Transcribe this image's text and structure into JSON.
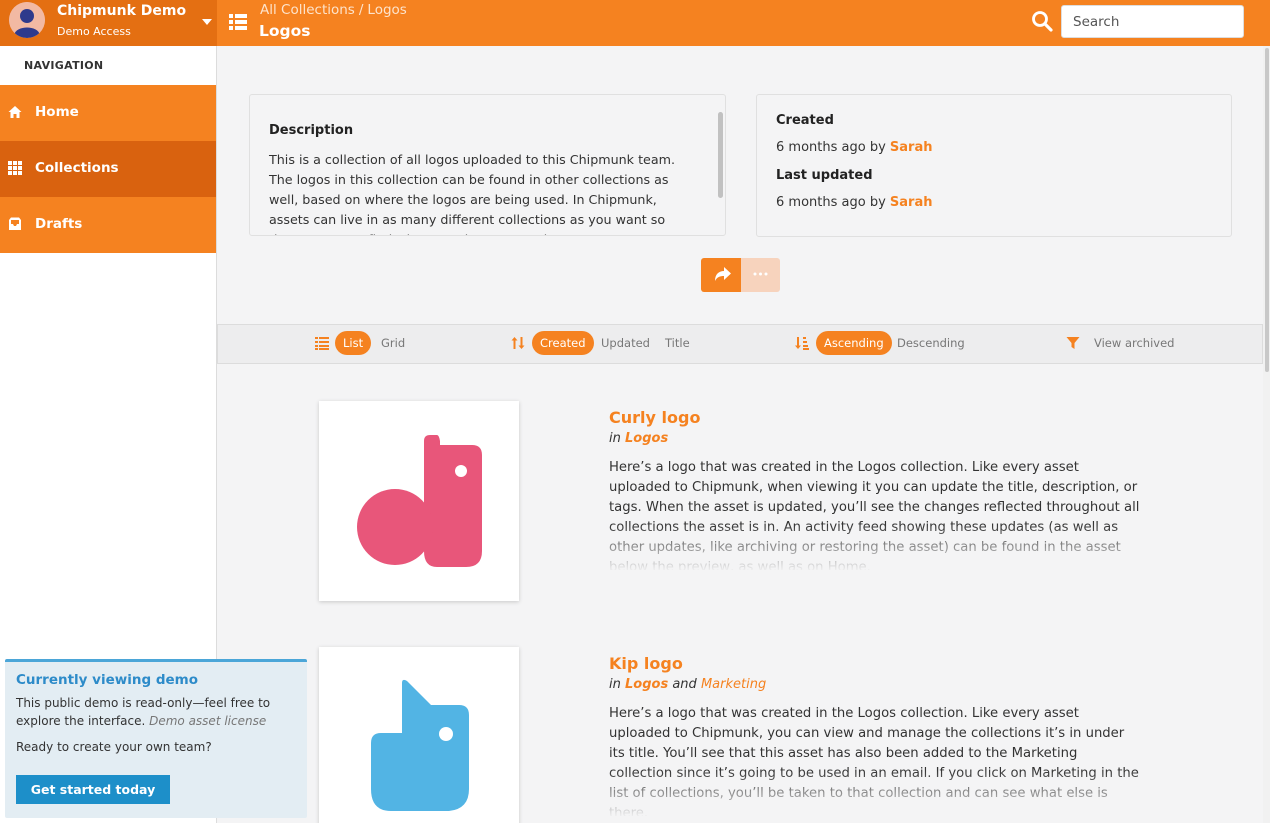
{
  "account": {
    "name": "Chipmunk Demo",
    "subtitle": "Demo Access"
  },
  "header": {
    "breadcrumb": [
      "All Collections",
      "Logos"
    ],
    "breadcrumb_separator": "/",
    "title": "Logos",
    "search_placeholder": "Search"
  },
  "sidebar": {
    "heading": "NAVIGATION",
    "items": [
      {
        "label": "Home",
        "icon": "home-icon",
        "active": false
      },
      {
        "label": "Collections",
        "icon": "grid-icon",
        "active": true
      },
      {
        "label": "Drafts",
        "icon": "inbox-icon",
        "active": false
      }
    ]
  },
  "demo_notice": {
    "title": "Currently viewing demo",
    "text": "This public demo is read-only—feel free to explore the interface.",
    "license_link": "Demo asset license",
    "question": "Ready to create your own team?",
    "button": "Get started today"
  },
  "collection": {
    "description_heading": "Description",
    "description": "This is a collection of all logos uploaded to this Chipmunk team. The logos in this collection can be found in other collections as well, based on where the logos are being used. In Chipmunk, assets can live in as many different collections as you want so they're easy to find wherever they are used.",
    "created_label": "Created",
    "created_time": "6 months ago",
    "created_by_prefix": "by",
    "created_by": "Sarah",
    "updated_label": "Last updated",
    "updated_time": "6 months ago",
    "updated_by_prefix": "by",
    "updated_by": "Sarah"
  },
  "toolbar": {
    "view_options": [
      "List",
      "Grid"
    ],
    "view_selected": "List",
    "sort_options": [
      "Created",
      "Updated",
      "Title"
    ],
    "sort_selected": "Created",
    "order_options": [
      "Ascending",
      "Descending"
    ],
    "order_selected": "Ascending",
    "archived_label": "View archived"
  },
  "assets": [
    {
      "title": "Curly logo",
      "in_prefix": "in",
      "collections": [
        "Logos"
      ],
      "joiner": "and",
      "logo_color": "#e8567a",
      "description": "Here’s a logo that was created in the Logos collection. Like every asset uploaded to Chipmunk, when viewing it you can update the title, description, or tags. When the asset is updated, you’ll see the changes reflected throughout all collections the asset is in. An activity feed showing these updates (as well as other updates, like archiving or restoring the asset) can be found in the asset below the preview, as well as on Home."
    },
    {
      "title": "Kip logo",
      "in_prefix": "in",
      "collections": [
        "Logos",
        "Marketing"
      ],
      "joiner": "and",
      "logo_color": "#52b4e4",
      "description": "Here’s a logo that was created in the Logos collection. Like every asset uploaded to Chipmunk, you can view and manage the collections it’s in under its title. You’ll see that this asset has also been added to the Marketing collection since it’s going to be used in an email. If you click on Marketing in the list of collections, you’ll be taken to that collection and can see what else is there."
    }
  ],
  "colors": {
    "brand_orange": "#f58220",
    "active_nav": "#d9620f",
    "demo_blue": "#1d8fc9"
  }
}
